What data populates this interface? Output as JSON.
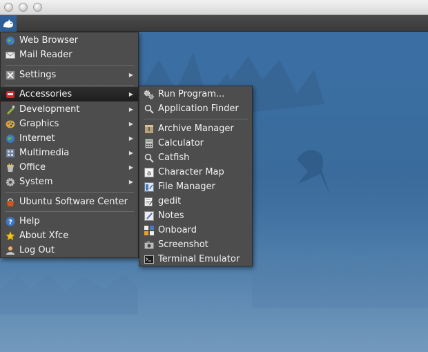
{
  "main_menu": {
    "items": [
      {
        "label": "Web Browser",
        "icon": "globe-icon"
      },
      {
        "label": "Mail Reader",
        "icon": "mail-icon"
      },
      {
        "label": "Settings",
        "icon": "settings-icon",
        "submenu": true
      },
      {
        "label": "Accessories",
        "icon": "accessories-icon",
        "submenu": true,
        "active": true
      },
      {
        "label": "Development",
        "icon": "development-icon",
        "submenu": true
      },
      {
        "label": "Graphics",
        "icon": "graphics-icon",
        "submenu": true
      },
      {
        "label": "Internet",
        "icon": "internet-icon",
        "submenu": true
      },
      {
        "label": "Multimedia",
        "icon": "multimedia-icon",
        "submenu": true
      },
      {
        "label": "Office",
        "icon": "office-icon",
        "submenu": true
      },
      {
        "label": "System",
        "icon": "system-icon",
        "submenu": true
      },
      {
        "label": "Ubuntu Software Center",
        "icon": "software-center-icon"
      },
      {
        "label": "Help",
        "icon": "help-icon"
      },
      {
        "label": "About Xfce",
        "icon": "star-icon"
      },
      {
        "label": "Log Out",
        "icon": "logout-icon"
      }
    ]
  },
  "accessories_menu": {
    "items": [
      {
        "label": "Run Program...",
        "icon": "run-program-icon"
      },
      {
        "label": "Application Finder",
        "icon": "search-icon"
      },
      {
        "label": "Archive Manager",
        "icon": "archive-icon"
      },
      {
        "label": "Calculator",
        "icon": "calculator-icon"
      },
      {
        "label": "Catfish",
        "icon": "search-icon"
      },
      {
        "label": "Character Map",
        "icon": "character-map-icon"
      },
      {
        "label": "File Manager",
        "icon": "file-manager-icon"
      },
      {
        "label": "gedit",
        "icon": "text-editor-icon"
      },
      {
        "label": "Notes",
        "icon": "notes-icon"
      },
      {
        "label": "Onboard",
        "icon": "keyboard-icon"
      },
      {
        "label": "Screenshot",
        "icon": "camera-icon"
      },
      {
        "label": "Terminal Emulator",
        "icon": "terminal-icon"
      }
    ]
  },
  "colors": {
    "menu_bg": "#4d4d4d",
    "highlight": "#252525",
    "desktop": "#3a6b9c",
    "panel_button": "#2f5f96"
  }
}
